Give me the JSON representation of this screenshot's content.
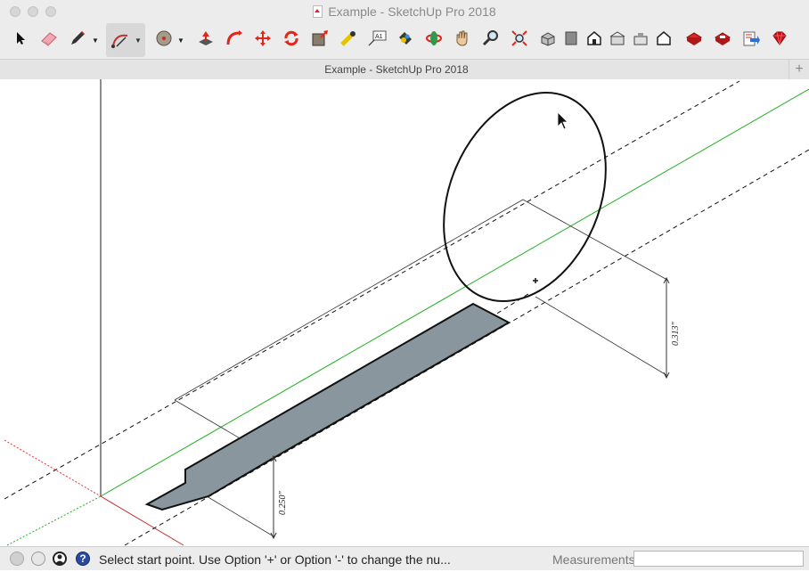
{
  "window": {
    "title": "Example - SketchUp Pro 2018"
  },
  "tabbar": {
    "document_title": "Example - SketchUp Pro 2018",
    "add_tab_label": "+"
  },
  "toolbar": {
    "tools": [
      {
        "name": "select-icon"
      },
      {
        "name": "eraser-icon"
      },
      {
        "name": "pencil-line-icon"
      },
      {
        "name": "arc-icon"
      },
      {
        "name": "circle-shapes-icon"
      },
      {
        "name": "push-pull-icon"
      },
      {
        "name": "follow-me-icon"
      },
      {
        "name": "move-icon"
      },
      {
        "name": "rotate-icon"
      },
      {
        "name": "scale-icon"
      },
      {
        "name": "tape-measure-icon"
      },
      {
        "name": "text-label-icon"
      },
      {
        "name": "paint-bucket-icon"
      },
      {
        "name": "orbit-icon"
      },
      {
        "name": "pan-hand-icon"
      },
      {
        "name": "zoom-icon"
      },
      {
        "name": "zoom-extents-icon"
      },
      {
        "name": "iso-view-icon"
      },
      {
        "name": "top-view-icon"
      },
      {
        "name": "front-view-icon"
      },
      {
        "name": "right-view-icon"
      },
      {
        "name": "back-view-icon"
      },
      {
        "name": "left-view-icon"
      },
      {
        "name": "warehouse-icon"
      },
      {
        "name": "extension-warehouse-icon"
      },
      {
        "name": "send-to-layout-icon"
      },
      {
        "name": "ruby-console-icon"
      }
    ],
    "accent": "#e1261c"
  },
  "viewport": {
    "dimensions": [
      {
        "label": "0.313\""
      },
      {
        "label": "0.250\""
      }
    ],
    "axis_colors": {
      "red": "#d63a3a",
      "green": "#22b022",
      "blue": "#1a1a1a"
    },
    "face_color": "#8a969d"
  },
  "statusbar": {
    "message": "Select start point. Use Option '+' or Option '-' to change the nu...",
    "measurements_label": "Measurements",
    "measurements_value": ""
  }
}
